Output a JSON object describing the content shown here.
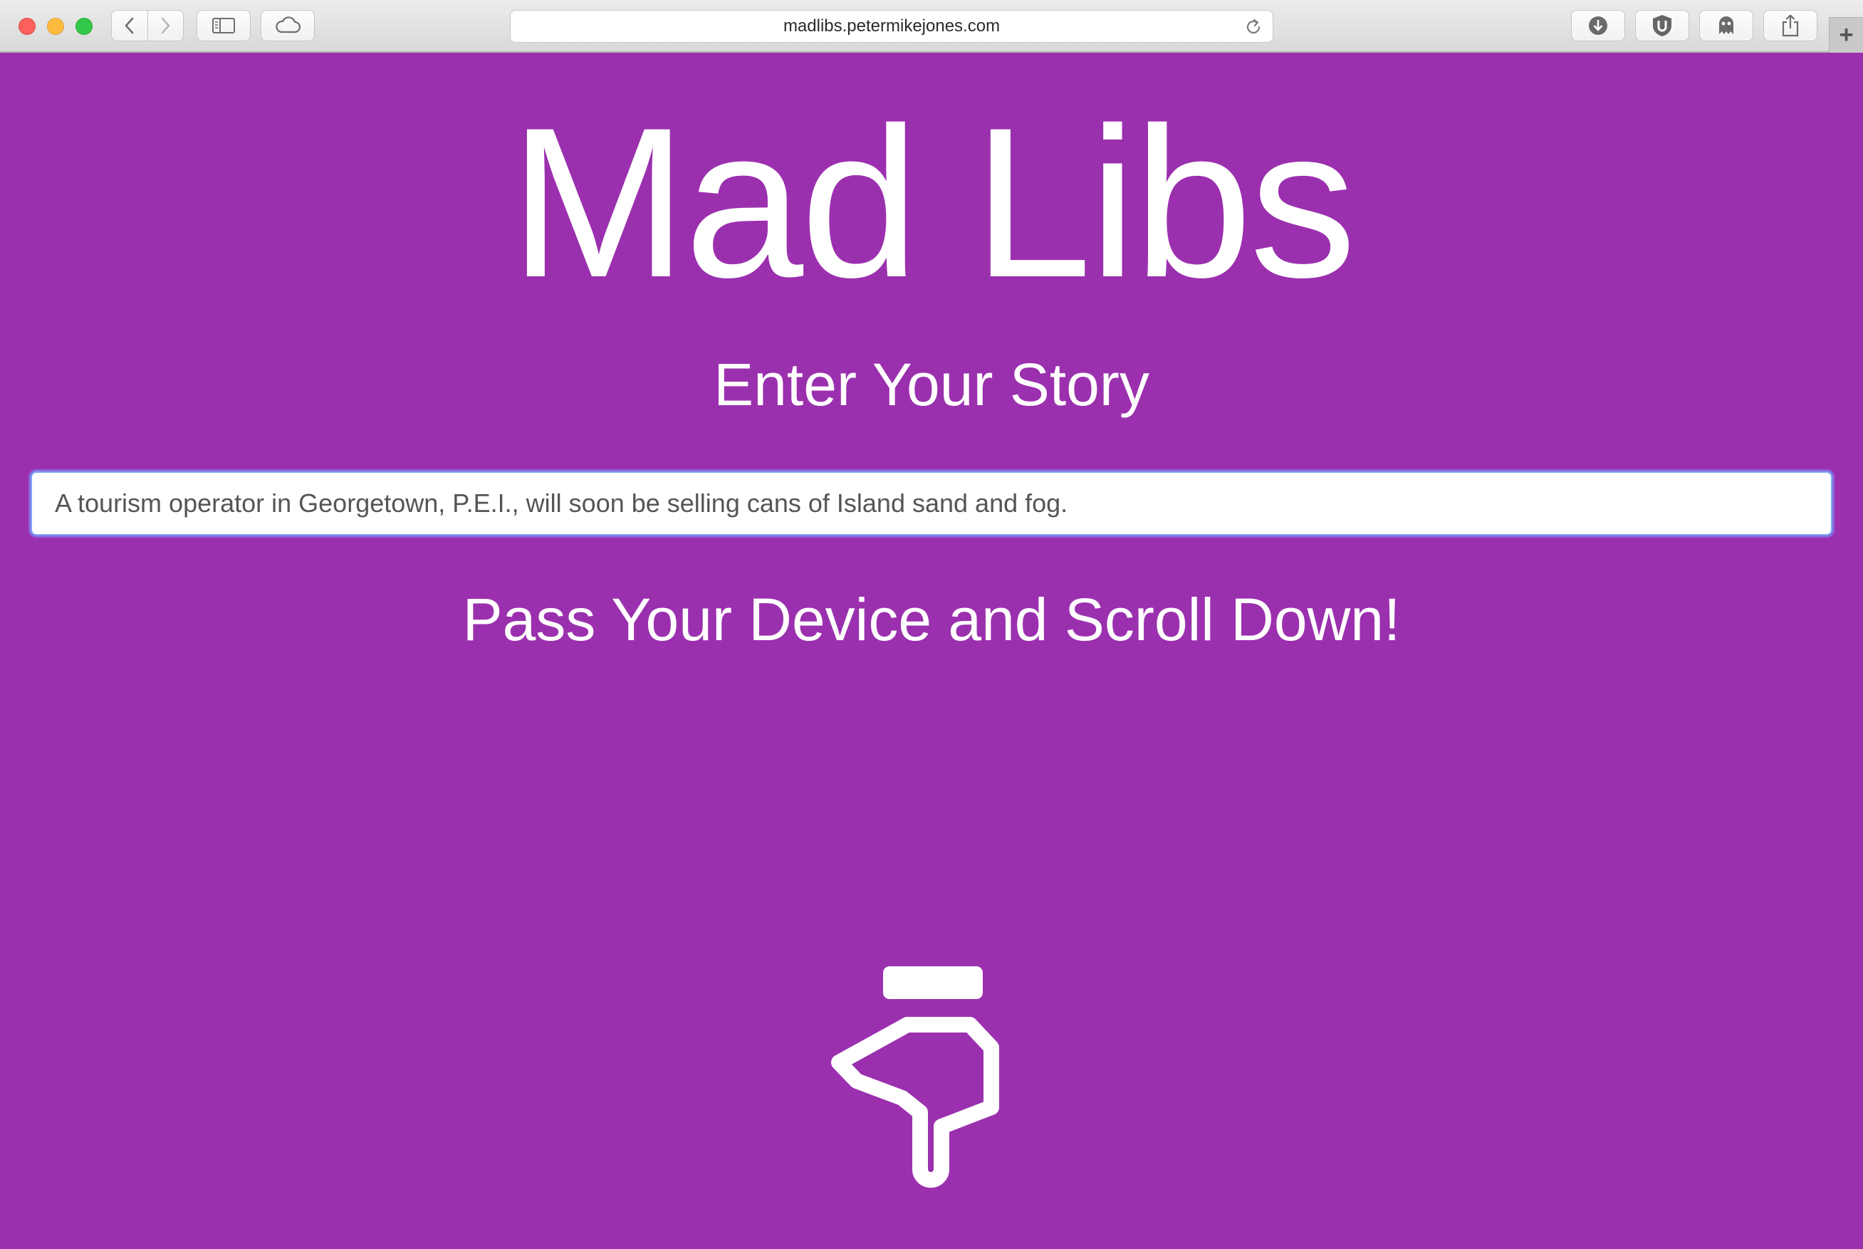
{
  "browser": {
    "url": "madlibs.petermikejones.com",
    "new_tab_label": "+"
  },
  "page": {
    "title": "Mad Libs",
    "subtitle": "Enter Your Story",
    "story_value": "A tourism operator in Georgetown, P.E.I., will soon be selling cans of Island sand and fog.",
    "instruction": "Pass Your Device and Scroll Down!",
    "icon": "pointing-down-hand-icon"
  },
  "colors": {
    "background": "#9b30af",
    "text": "#ffffff",
    "input_focus": "#80a8f6"
  }
}
